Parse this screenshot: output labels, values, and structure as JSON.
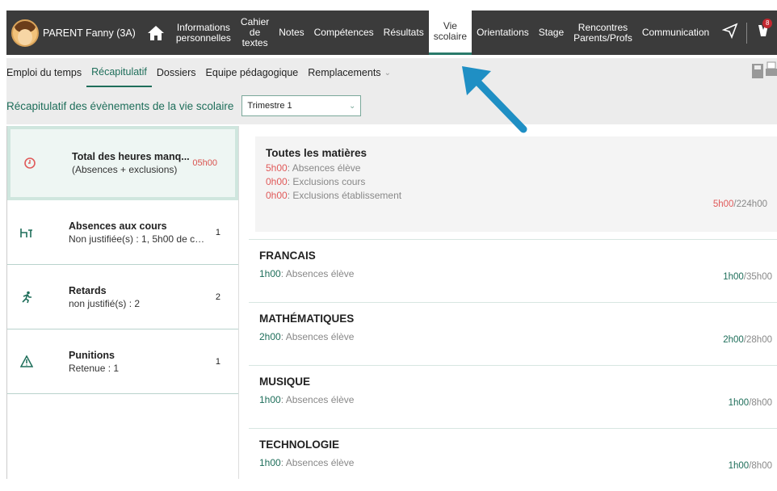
{
  "header": {
    "username": "PARENT Fanny (3A)",
    "nav": [
      {
        "label": "Informations\npersonnelles"
      },
      {
        "label": "Cahier\nde textes"
      },
      {
        "label": "Notes"
      },
      {
        "label": "Compétences"
      },
      {
        "label": "Résultats"
      },
      {
        "label": "Vie\nscolaire",
        "active": true
      },
      {
        "label": "Orientations"
      },
      {
        "label": "Stage"
      },
      {
        "label": "Rencontres\nParents/Profs"
      },
      {
        "label": "Communication"
      }
    ],
    "notifications_count": "8"
  },
  "subnav": {
    "tabs": [
      {
        "label": "Emploi du temps"
      },
      {
        "label": "Récapitulatif",
        "active": true
      },
      {
        "label": "Dossiers"
      },
      {
        "label": "Equipe pédagogique"
      },
      {
        "label": "Remplacements"
      }
    ]
  },
  "filter": {
    "title": "Récapitulatif des évènements de la vie scolaire",
    "period": "Trimestre 1"
  },
  "left_panel": [
    {
      "title": "Total des heures manq...",
      "detail": "(Absences + exclusions)",
      "value": "05h00",
      "icon": "clock-icon",
      "active": true
    },
    {
      "title": "Absences aux cours",
      "detail": "Non justifiée(s) : 1, 5h00 de cou...",
      "value": "1",
      "icon": "desk-icon"
    },
    {
      "title": "Retards",
      "detail": "non justifié(s) : 2",
      "value": "2",
      "icon": "running-icon"
    },
    {
      "title": "Punitions",
      "detail": "Retenue : 1",
      "value": "1",
      "icon": "warning-icon"
    }
  ],
  "summary": {
    "title": "Toutes les matières",
    "rows": [
      {
        "value": "5h00",
        "label": ": Absences élève"
      },
      {
        "value": "0h00",
        "label": ": Exclusions cours"
      },
      {
        "value": "0h00",
        "label": ": Exclusions établissement"
      }
    ],
    "total_value": "5h00",
    "total_rest": "/224h00"
  },
  "subjects": [
    {
      "name": "FRANCAIS",
      "value": "1h00",
      "label": ": Absences élève",
      "total_value": "1h00",
      "total_rest": "/35h00"
    },
    {
      "name": "MATHÉMATIQUES",
      "value": "2h00",
      "label": ": Absences élève",
      "total_value": "2h00",
      "total_rest": "/28h00"
    },
    {
      "name": "MUSIQUE",
      "value": "1h00",
      "label": ": Absences élève",
      "total_value": "1h00",
      "total_rest": "/8h00"
    },
    {
      "name": "TECHNOLOGIE",
      "value": "1h00",
      "label": ": Absences élève",
      "total_value": "1h00",
      "total_rest": "/8h00"
    }
  ],
  "colors": {
    "accent": "#1e6e5a",
    "alert": "#e05a5a",
    "topbar": "#3b3b3b",
    "arrow": "#1f8fc4"
  }
}
